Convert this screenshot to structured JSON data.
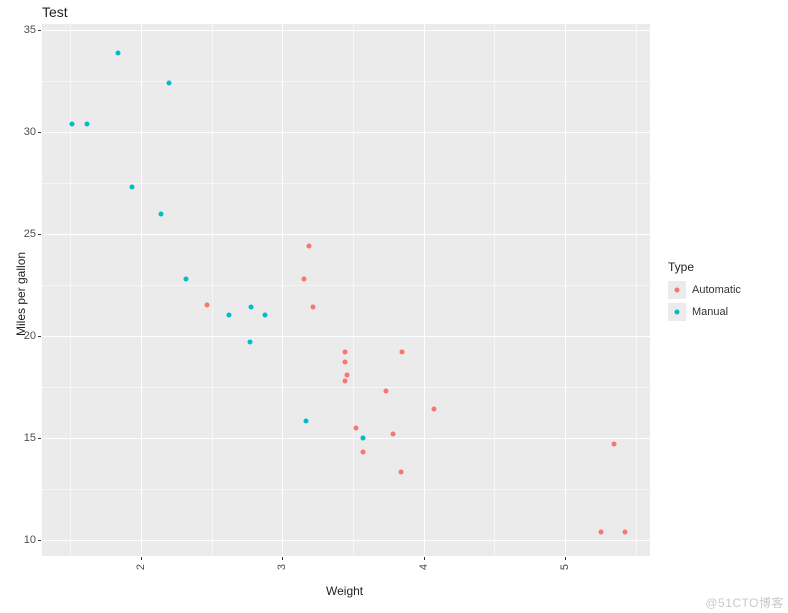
{
  "chart_data": {
    "type": "scatter",
    "title": "Test",
    "xlabel": "Weight",
    "ylabel": "Miles per gallon",
    "xlim": [
      1.3,
      5.6
    ],
    "ylim": [
      9.2,
      35.3
    ],
    "x_ticks": [
      2,
      3,
      4,
      5
    ],
    "y_ticks": [
      10,
      15,
      20,
      25,
      30,
      35
    ],
    "legend_title": "Type",
    "series": [
      {
        "name": "Automatic",
        "color": "#F8766D",
        "points": [
          {
            "x": 2.465,
            "y": 21.5
          },
          {
            "x": 3.15,
            "y": 22.8
          },
          {
            "x": 3.19,
            "y": 24.4
          },
          {
            "x": 3.215,
            "y": 21.4
          },
          {
            "x": 3.44,
            "y": 19.2
          },
          {
            "x": 3.44,
            "y": 18.7
          },
          {
            "x": 3.46,
            "y": 18.1
          },
          {
            "x": 3.44,
            "y": 17.8
          },
          {
            "x": 3.57,
            "y": 15.0
          },
          {
            "x": 3.52,
            "y": 15.5
          },
          {
            "x": 3.57,
            "y": 14.3
          },
          {
            "x": 3.73,
            "y": 17.3
          },
          {
            "x": 3.78,
            "y": 15.2
          },
          {
            "x": 3.84,
            "y": 13.3
          },
          {
            "x": 3.845,
            "y": 19.2
          },
          {
            "x": 4.07,
            "y": 16.4
          },
          {
            "x": 5.25,
            "y": 10.4
          },
          {
            "x": 5.345,
            "y": 14.7
          },
          {
            "x": 5.424,
            "y": 10.4
          }
        ]
      },
      {
        "name": "Manual",
        "color": "#00BFC4",
        "points": [
          {
            "x": 1.513,
            "y": 30.4
          },
          {
            "x": 1.615,
            "y": 30.4
          },
          {
            "x": 1.835,
            "y": 33.9
          },
          {
            "x": 1.935,
            "y": 27.3
          },
          {
            "x": 2.14,
            "y": 26.0
          },
          {
            "x": 2.2,
            "y": 32.4
          },
          {
            "x": 2.32,
            "y": 22.8
          },
          {
            "x": 2.62,
            "y": 21.0
          },
          {
            "x": 2.77,
            "y": 19.7
          },
          {
            "x": 2.78,
            "y": 21.4
          },
          {
            "x": 2.875,
            "y": 21.0
          },
          {
            "x": 3.17,
            "y": 15.8
          },
          {
            "x": 3.57,
            "y": 15.0
          }
        ]
      }
    ]
  },
  "watermark": "@51CTO博客"
}
